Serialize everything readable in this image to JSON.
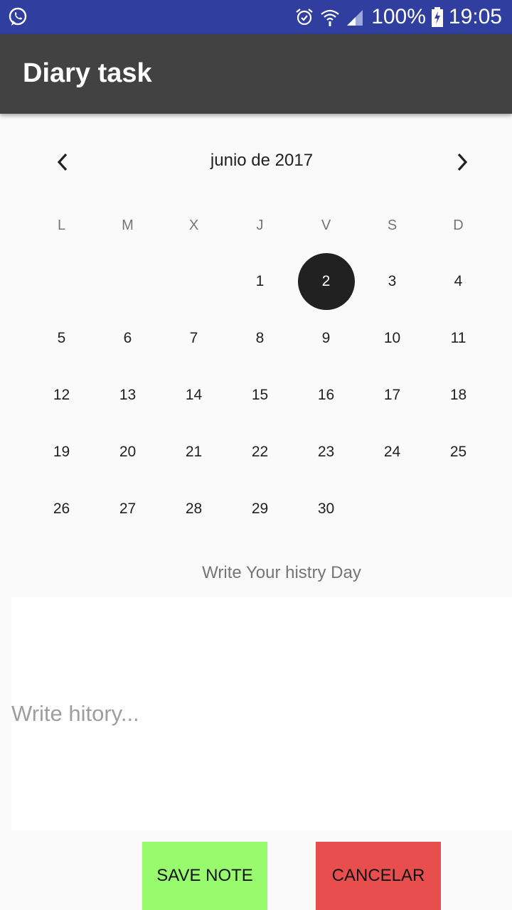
{
  "status_bar": {
    "battery": "100%",
    "time": "19:05",
    "icons": [
      "whatsapp-icon",
      "alarm-icon",
      "wifi-icon",
      "signal-icon",
      "battery-charging-icon"
    ]
  },
  "app_bar": {
    "title": "Diary task"
  },
  "calendar": {
    "month_label": "junio de 2017",
    "weekdays": [
      "L",
      "M",
      "X",
      "J",
      "V",
      "S",
      "D"
    ],
    "leading_blanks": 3,
    "days": [
      "1",
      "2",
      "3",
      "4",
      "5",
      "6",
      "7",
      "8",
      "9",
      "10",
      "11",
      "12",
      "13",
      "14",
      "15",
      "16",
      "17",
      "18",
      "19",
      "20",
      "21",
      "22",
      "23",
      "24",
      "25",
      "26",
      "27",
      "28",
      "29",
      "30"
    ],
    "selected_day": "2"
  },
  "history": {
    "label": "Write Your histry Day",
    "value": "",
    "placeholder": "Write hitory..."
  },
  "actions": {
    "save_label": "SAVE NOTE",
    "cancel_label": "CANCELAR"
  },
  "colors": {
    "status_bar": "#303f9f",
    "app_bar": "#424242",
    "selected_day": "#212121",
    "save_button": "#98fb6e",
    "cancel_button": "#e84e4e"
  }
}
